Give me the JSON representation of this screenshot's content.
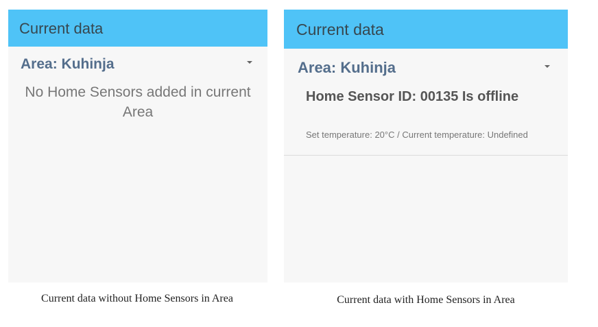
{
  "colors": {
    "app_bar": "#4fc3f7",
    "area_label": "#546e8c",
    "panel_background": "#f7f7f7"
  },
  "icons": {
    "dropdown": "caret-down-icon"
  },
  "left_screen": {
    "app_bar": {
      "title": "Current data"
    },
    "area_selector": {
      "selected": "Area:  Kuhinja"
    },
    "empty_message": "No Home Sensors added in current Area"
  },
  "right_screen": {
    "app_bar": {
      "title": "Current data"
    },
    "area_selector": {
      "selected": "Area:  Kuhinja"
    },
    "sensors": [
      {
        "title": "Home Sensor ID: 00135 Is offline",
        "details": "Set temperature: 20°C / Current temperature: Undefined"
      }
    ]
  },
  "captions": {
    "left": "Current data without Home Sensors in Area",
    "right": "Current data with Home Sensors in Area"
  }
}
